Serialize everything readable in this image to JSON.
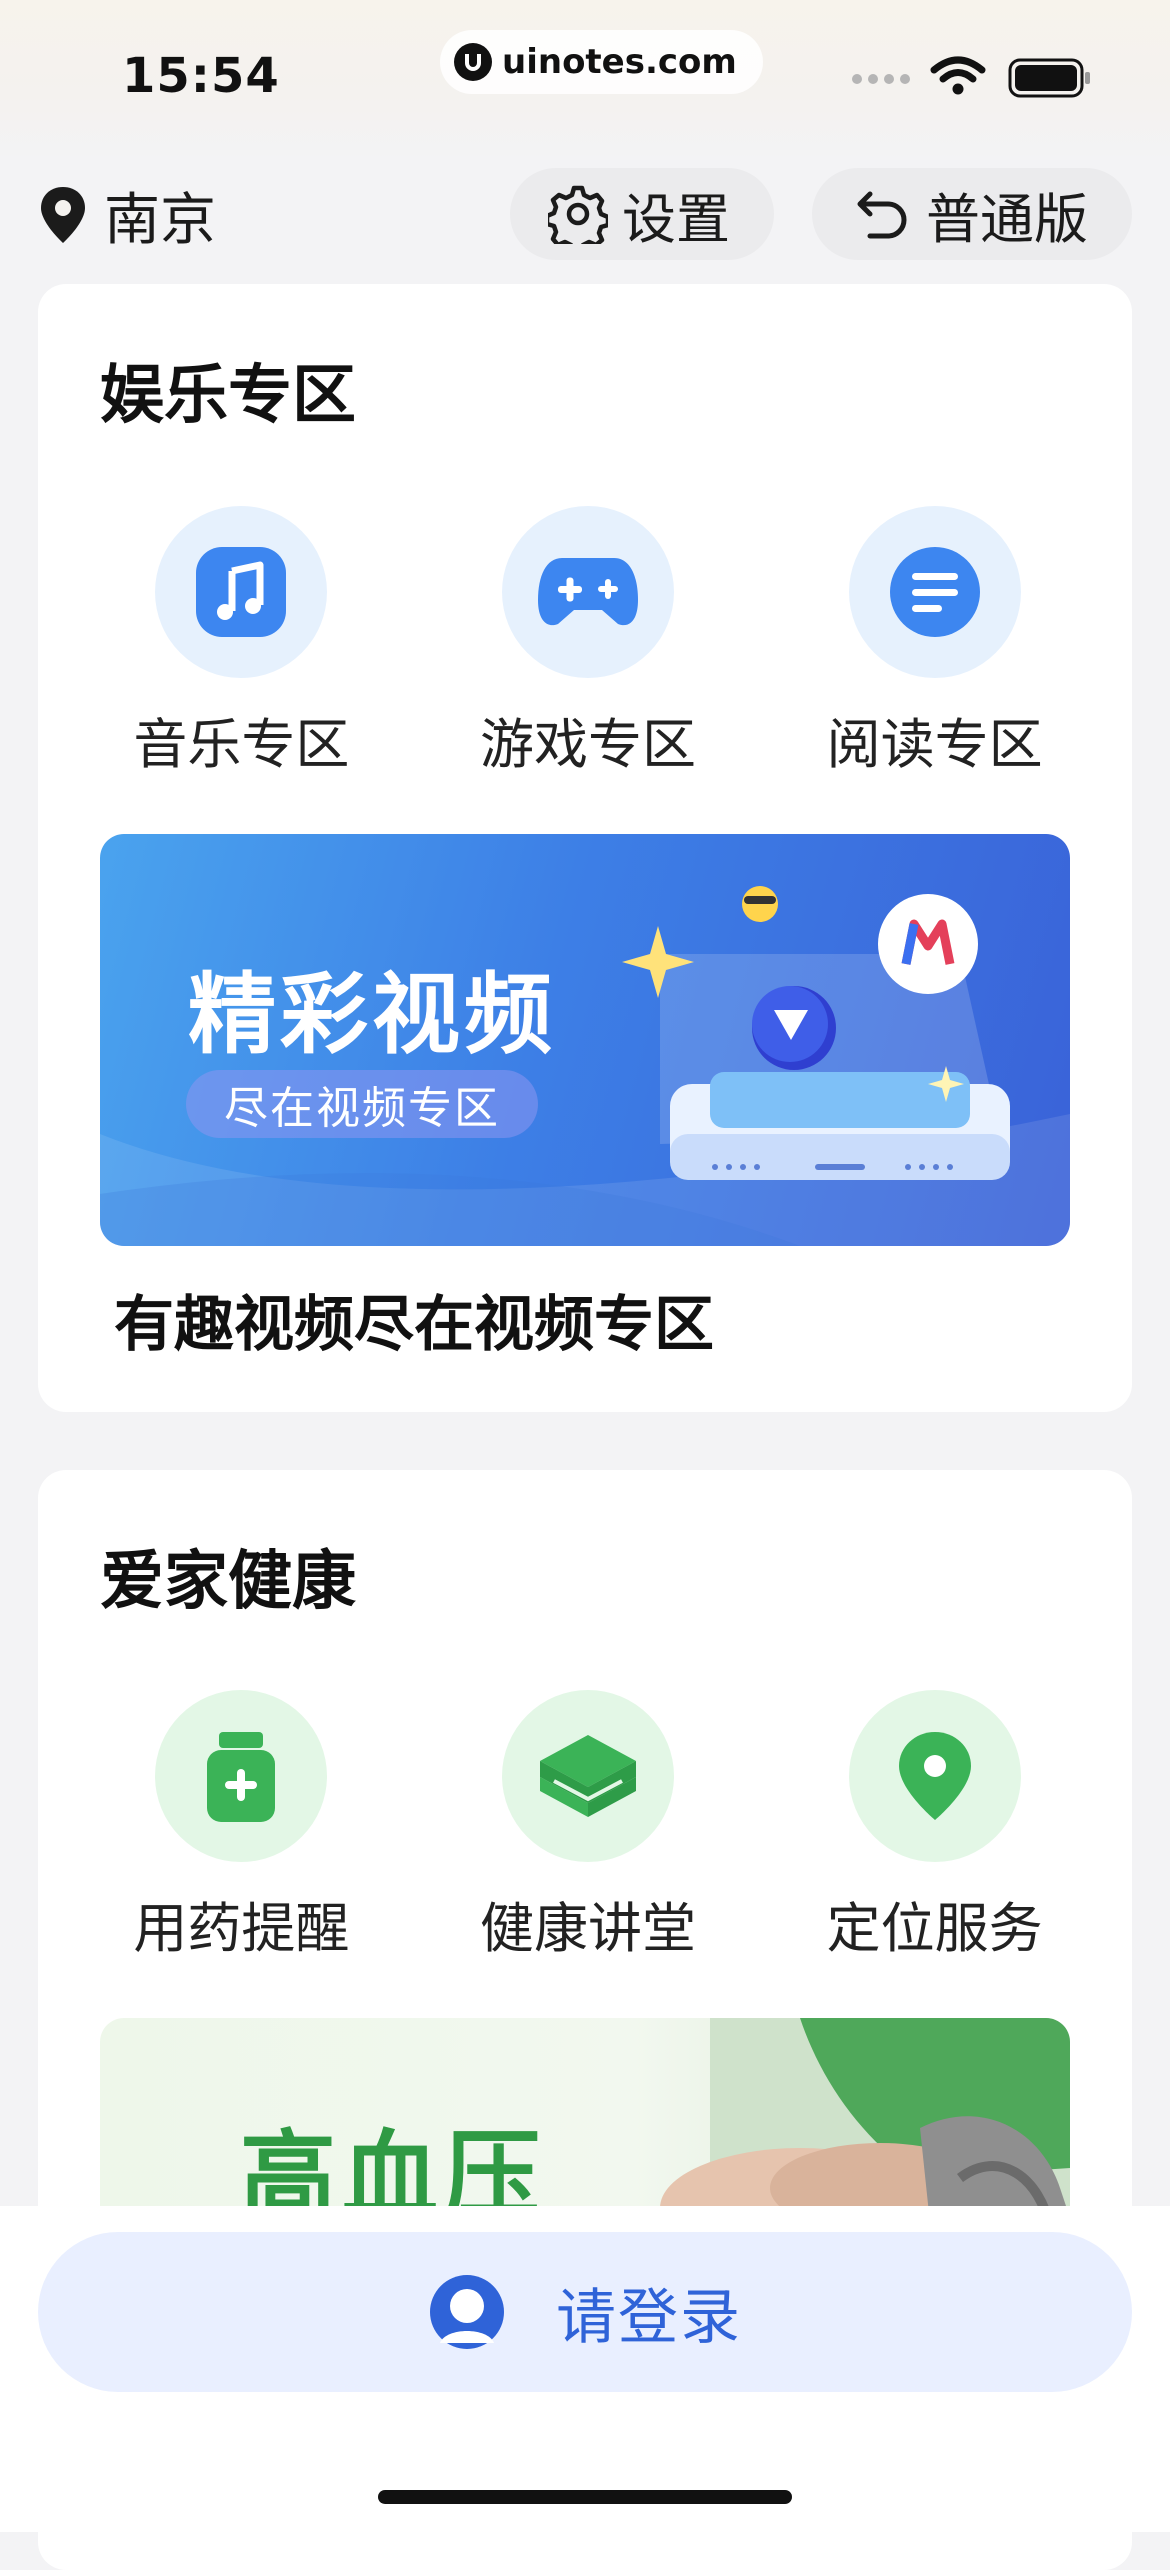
{
  "status_bar": {
    "time": "15:54",
    "url": "uinotes.com"
  },
  "header": {
    "city": "南京",
    "settings_label": "设置",
    "classic_label": "普通版"
  },
  "entertainment": {
    "title": "娱乐专区",
    "items": [
      {
        "label": "音乐专区",
        "icon": "music-note-icon"
      },
      {
        "label": "游戏专区",
        "icon": "gamepad-icon"
      },
      {
        "label": "阅读专区",
        "icon": "reading-icon"
      }
    ],
    "banner": {
      "title": "精彩视频",
      "subtitle": "尽在视频专区",
      "caption": "有趣视频尽在视频专区"
    }
  },
  "health": {
    "title": "爱家健康",
    "items": [
      {
        "label": "用药提醒",
        "icon": "medicine-bottle-icon"
      },
      {
        "label": "健康讲堂",
        "icon": "book-icon"
      },
      {
        "label": "定位服务",
        "icon": "location-pin-icon"
      }
    ],
    "banner": {
      "title": "高血压"
    }
  },
  "login": {
    "label": "请登录"
  },
  "colors": {
    "accent_blue": "#2f63d8",
    "icon_blue": "#3d86f0",
    "icon_green": "#3bb357",
    "health_green": "#2f9a44"
  }
}
